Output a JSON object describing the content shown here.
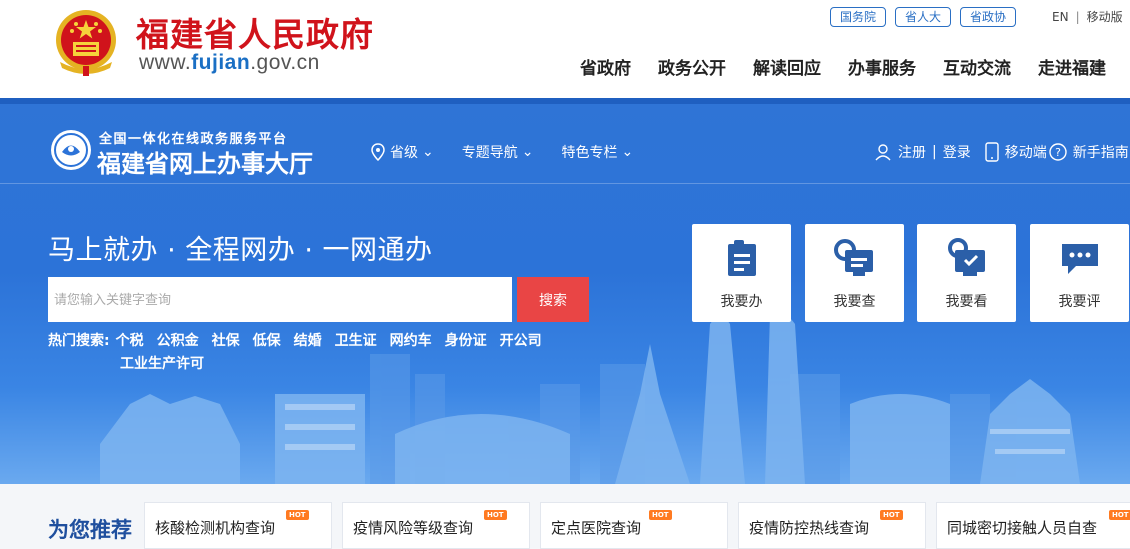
{
  "header": {
    "title": "福建省人民政府",
    "url_prefix": "www.",
    "url_domain": "fujian",
    "url_suffix": ".gov.cn",
    "top_links": [
      "国务院",
      "省人大",
      "省政协"
    ],
    "lang_en": "EN",
    "lang_sep": "|",
    "mobile": "移动版",
    "nav": [
      "省政府",
      "政务公开",
      "解读回应",
      "办事服务",
      "互动交流",
      "走进福建"
    ]
  },
  "hall": {
    "subtitle": "全国一体化在线政务服务平台",
    "name": "福建省网上办事大厅",
    "nav": [
      "省级",
      "专题导航",
      "特色专栏"
    ],
    "register": "注册",
    "divider": "|",
    "login": "登录",
    "mobile": "移动端",
    "guide": "新手指南"
  },
  "hero": {
    "slogan": "马上就办 · 全程网办 · 一网通办",
    "search_placeholder": "请您输入关键字查询",
    "search_button": "搜索",
    "hot_label": "热门搜索:",
    "hot_items": [
      "个税",
      "公积金",
      "社保",
      "低保",
      "结婚",
      "卫生证",
      "网约车",
      "身份证",
      "开公司"
    ],
    "hot_items_line2": [
      "工业生产许可"
    ]
  },
  "quick_actions": [
    {
      "label": "我要办",
      "icon": "handle-icon"
    },
    {
      "label": "我要查",
      "icon": "query-icon"
    },
    {
      "label": "我要看",
      "icon": "view-icon"
    },
    {
      "label": "我要评",
      "icon": "comment-icon"
    }
  ],
  "recommend": {
    "title": "为您推荐",
    "badge": "HOT",
    "items": [
      "核酸检测机构查询",
      "疫情风险等级查询",
      "定点医院查询",
      "疫情防控热线查询",
      "同城密切接触人员自查"
    ]
  },
  "colors": {
    "brand_red": "#d0131b",
    "hero_blue": "#2c73d8",
    "search_red": "#e94545",
    "recommend_title": "#1f4f9e",
    "hot_badge": "#ff7a21"
  }
}
